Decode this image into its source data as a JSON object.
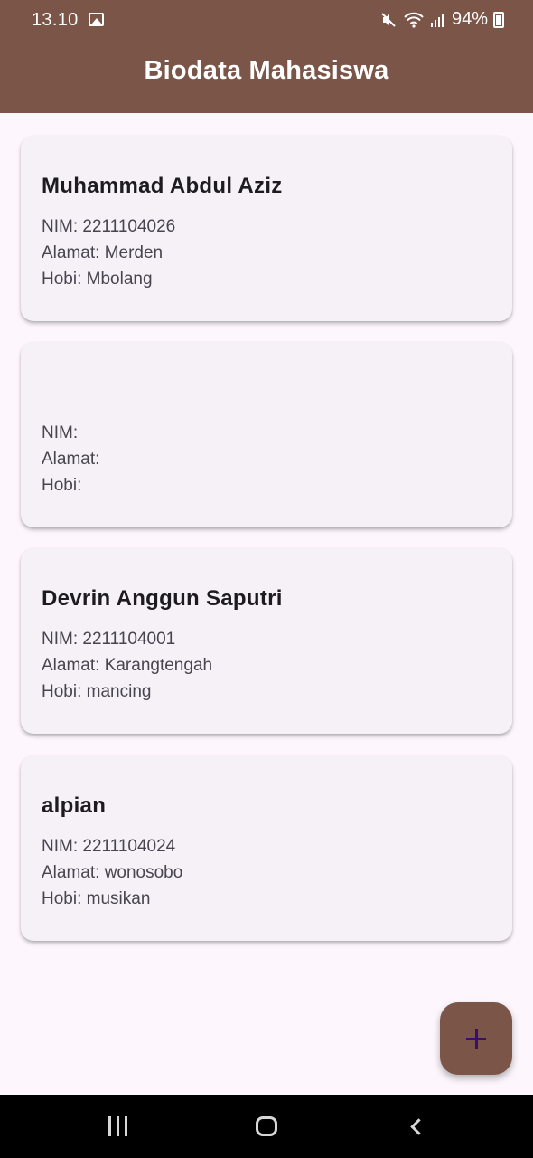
{
  "status_bar": {
    "time": "13.10",
    "battery": "94%",
    "icons": [
      "gallery-icon",
      "mute-icon",
      "wifi-icon",
      "signal-icon",
      "battery-icon"
    ]
  },
  "app_bar": {
    "title": "Biodata Mahasiswa"
  },
  "students": [
    {
      "name": "Muhammad Abdul Aziz",
      "nim": "NIM: 2211104026",
      "alamat": "Alamat: Merden",
      "hobi": "Hobi: Mbolang"
    },
    {
      "name": "",
      "nim": "NIM:",
      "alamat": "Alamat:",
      "hobi": "Hobi:"
    },
    {
      "name": "Devrin Anggun Saputri",
      "nim": "NIM: 2211104001",
      "alamat": "Alamat: Karangtengah",
      "hobi": "Hobi: mancing"
    },
    {
      "name": "alpian",
      "nim": "NIM: 2211104024",
      "alamat": "Alamat: wonosobo",
      "hobi": "Hobi: musikan"
    }
  ],
  "fab": {
    "icon": "plus-icon"
  },
  "colors": {
    "primary": "#7a5548",
    "background": "#fdf7fd",
    "card": "#f5f1f7",
    "fab_icon": "#3a0f66"
  }
}
